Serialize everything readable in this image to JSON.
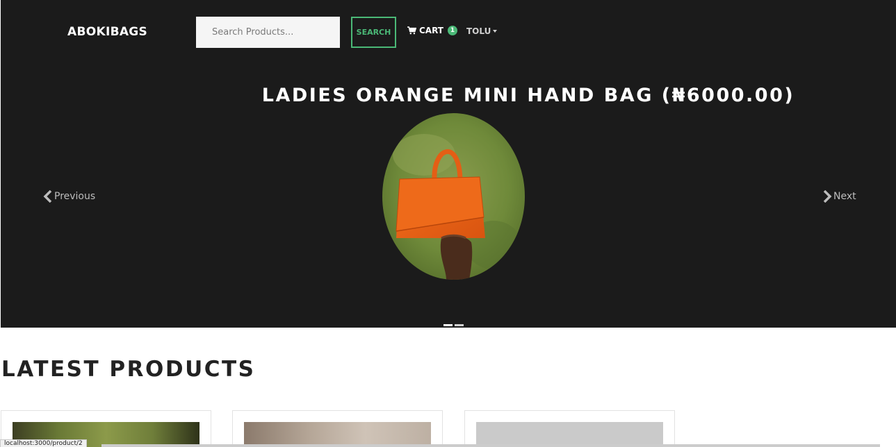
{
  "navbar": {
    "brand": "ABOKIBAGS",
    "search": {
      "placeholder": "Search Products...",
      "button_label": "SEARCH"
    },
    "cart": {
      "label": "CART",
      "count": "1"
    },
    "user": {
      "label": "TOLU"
    }
  },
  "carousel": {
    "title": "LADIES ORANGE MINI HAND BAG (₦6000.00)",
    "prev_label": "Previous",
    "next_label": "Next",
    "slide_count": 2,
    "active_index": 0
  },
  "latest": {
    "title": "LATEST PRODUCTS"
  },
  "status_bar": {
    "url": "localhost:3000/product/2"
  },
  "colors": {
    "background_dark": "#1b1b1b",
    "accent_green": "#4bb977",
    "bag_orange": "#e85f17"
  },
  "icons": {
    "cart": "shopping-cart-icon",
    "user_caret": "caret-down-icon",
    "prev": "chevron-left-icon",
    "next": "chevron-right-icon"
  }
}
